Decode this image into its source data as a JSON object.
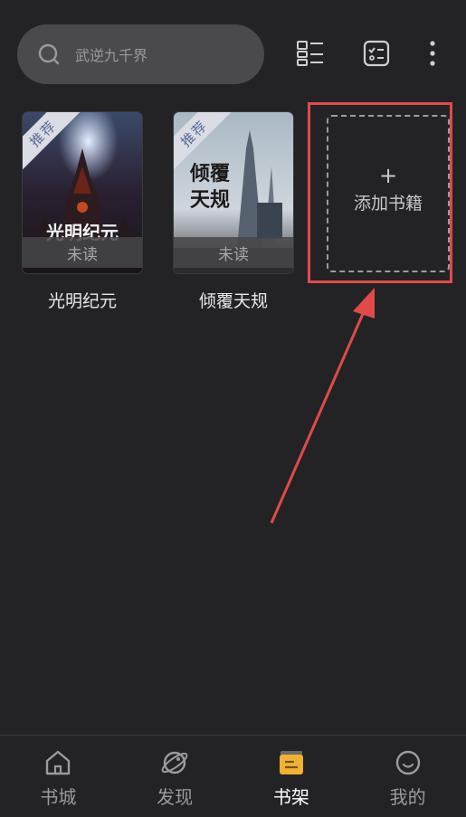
{
  "search": {
    "placeholder": "武逆九千界"
  },
  "toolbar": {
    "icons": [
      "list-view-icon",
      "checklist-icon",
      "more-vertical-icon"
    ]
  },
  "books": [
    {
      "title": "光明纪元",
      "ribbon": "推荐",
      "status": "未读",
      "cover_text": "光明纪元"
    },
    {
      "title": "倾覆天规",
      "ribbon": "推荐",
      "status": "未读",
      "cover_text": "倾覆天规"
    }
  ],
  "add_book": {
    "plus": "+",
    "label": "添加书籍"
  },
  "tabs": [
    {
      "label": "书城",
      "icon": "home-icon",
      "active": false
    },
    {
      "label": "发现",
      "icon": "discover-icon",
      "active": false
    },
    {
      "label": "书架",
      "icon": "bookshelf-icon",
      "active": true
    },
    {
      "label": "我的",
      "icon": "profile-icon",
      "active": false
    }
  ],
  "colors": {
    "background": "#232325",
    "highlight": "#e24a4a",
    "active_tab_icon": "#f0b232"
  }
}
